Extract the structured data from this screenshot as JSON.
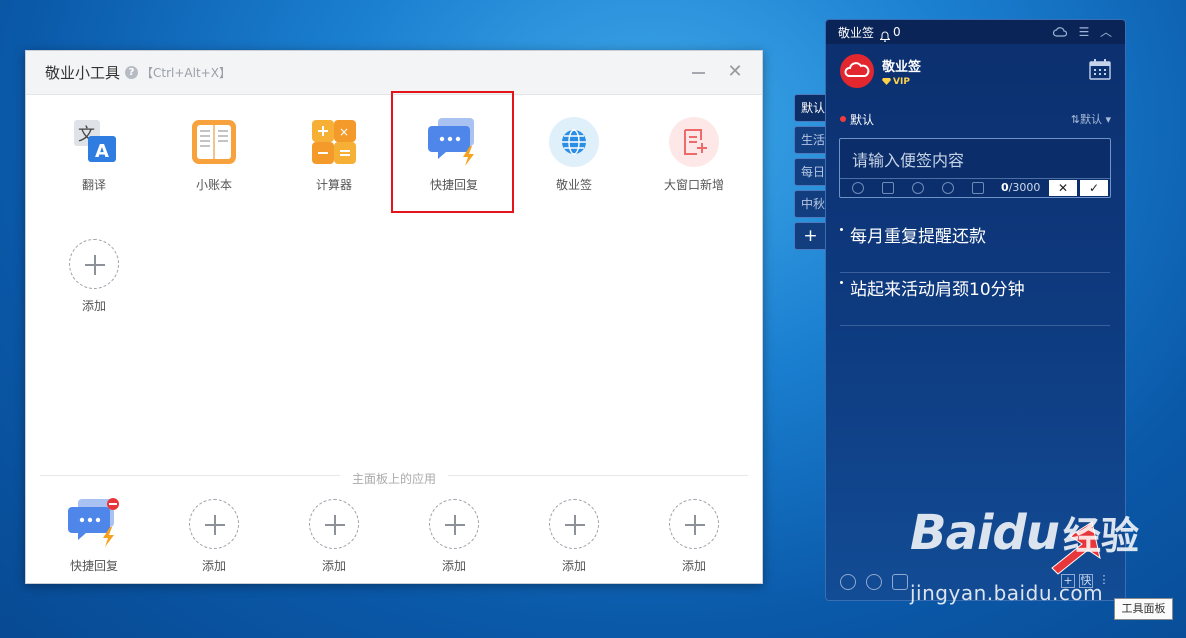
{
  "tool_window": {
    "title": "敬业小工具",
    "shortcut": "【Ctrl+Alt+X】",
    "tools": [
      {
        "label": "翻译",
        "icon": "translate-icon"
      },
      {
        "label": "小账本",
        "icon": "ledger-icon"
      },
      {
        "label": "计算器",
        "icon": "calculator-icon"
      },
      {
        "label": "快捷回复",
        "icon": "quick-reply-icon"
      },
      {
        "label": "敬业签",
        "icon": "globe-icon"
      },
      {
        "label": "大窗口新增",
        "icon": "note-add-icon"
      }
    ],
    "add_label": "添加",
    "section_label": "主面板上的应用",
    "main_panel_apps": [
      {
        "label": "快捷回复",
        "icon": "quick-reply-icon"
      },
      {
        "label": "添加"
      },
      {
        "label": "添加"
      },
      {
        "label": "添加"
      },
      {
        "label": "添加"
      },
      {
        "label": "添加"
      }
    ]
  },
  "note_panel": {
    "title": "敬业签",
    "notification_count": "0",
    "user_name": "敬业签",
    "vip_label": "VIP",
    "category": "默认",
    "sort_label": "默认",
    "input_placeholder": "请输入便签内容",
    "char_count": "0",
    "char_limit": "/3000",
    "notes": [
      "每月重复提醒还款",
      "站起来活动肩颈10分钟"
    ],
    "side_tabs": [
      "默认",
      "生活",
      "每日",
      "中秋",
      "+"
    ],
    "tooltip": "工具面板",
    "bottom_right_buttons": [
      "+",
      "快",
      "⋮"
    ]
  },
  "watermark": {
    "logo": "Baidu",
    "brand": "经验",
    "url": "jingyan.baidu.com"
  },
  "colors": {
    "highlight": "#e4141b",
    "panel_bg": "#0e3a7f",
    "desktop": "#1b7fd0"
  }
}
